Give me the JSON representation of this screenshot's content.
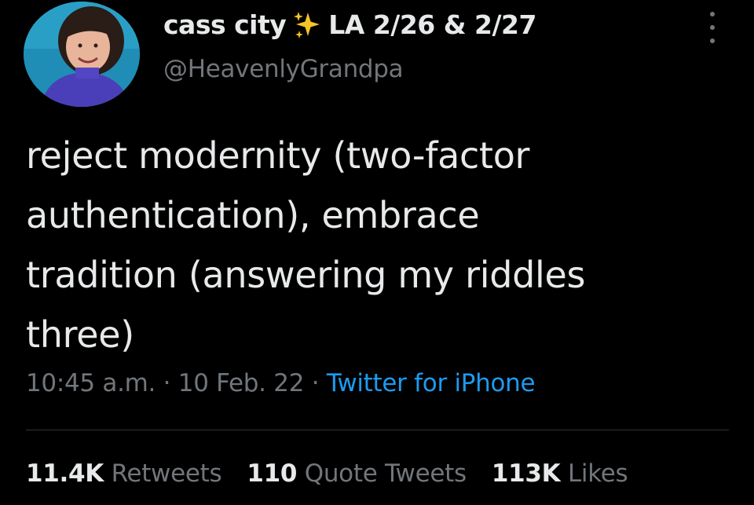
{
  "author": {
    "display_name": "cass city",
    "name_suffix": "LA 2/26 & 2/27",
    "handle": "@HeavenlyGrandpa",
    "avatar_icon": "profile-photo",
    "badge_icon": "sparkles-emoji"
  },
  "tweet": {
    "text_lines": [
      "reject modernity (two-factor",
      "authentication), embrace",
      "tradition (answering my riddles",
      "three)"
    ],
    "time": "10:45 a.m.",
    "separator": "·",
    "date": "10 Feb. 22",
    "source": "Twitter for iPhone"
  },
  "stats": {
    "retweets_count": "11.4K",
    "retweets_label": "Retweets",
    "quotes_count": "110",
    "quotes_label": "Quote Tweets",
    "likes_count": "113K",
    "likes_label": "Likes"
  },
  "colors": {
    "background": "#000000",
    "text_primary": "#e7e9ea",
    "text_secondary": "#71767b",
    "link": "#1d9bf0",
    "divider": "#2f3336"
  }
}
